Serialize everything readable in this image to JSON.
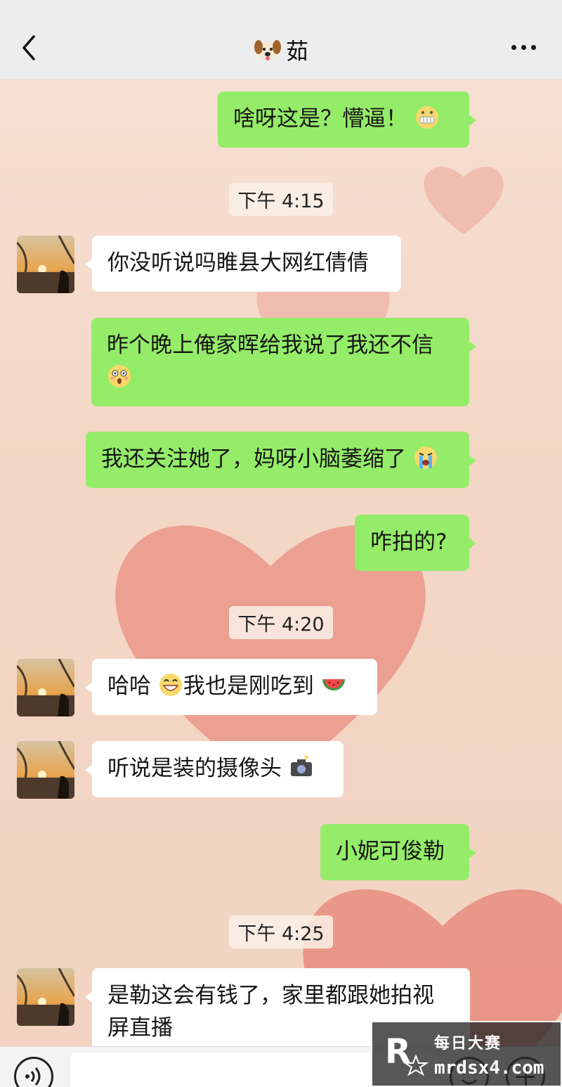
{
  "header": {
    "title": "茹",
    "title_icon": "dog-face-emoji",
    "back_icon": "chevron-left-icon",
    "more_icon": "more-dots-icon"
  },
  "messages": [
    {
      "side": "right",
      "text": "啥呀这是？懵逼！",
      "emoji": "grimace-emoji"
    },
    {
      "type": "time",
      "text": "下午 4:15"
    },
    {
      "side": "left",
      "text": "你没听说吗睢县大网红倩倩"
    },
    {
      "side": "right",
      "text": "昨个晚上俺家晖给我说了我还不信",
      "emoji": "shocked-emoji"
    },
    {
      "side": "right",
      "text": "我还关注她了，妈呀小脑萎缩了",
      "emoji": "crying-emoji"
    },
    {
      "side": "right",
      "text": "咋拍的?"
    },
    {
      "type": "time",
      "text": "下午 4:20"
    },
    {
      "side": "left",
      "text_a": "哈哈",
      "text_b": "我也是刚吃到",
      "emoji_a": "grin-emoji",
      "emoji_b": "watermelon-emoji"
    },
    {
      "side": "left",
      "text": "听说是装的摄像头",
      "emoji": "camera-flash-emoji"
    },
    {
      "side": "right",
      "text": "小妮可俊勒"
    },
    {
      "type": "time",
      "text": "下午 4:25"
    },
    {
      "side": "left",
      "text": "是勒这会有钱了，家里都跟她拍视屏直播"
    }
  ],
  "input_bar": {
    "voice_icon": "voice-icon",
    "emoji_icon": "emoji-icon",
    "plus_icon": "plus-icon"
  },
  "watermark": {
    "title": "每日大赛",
    "url": "mrdsx4.com"
  }
}
